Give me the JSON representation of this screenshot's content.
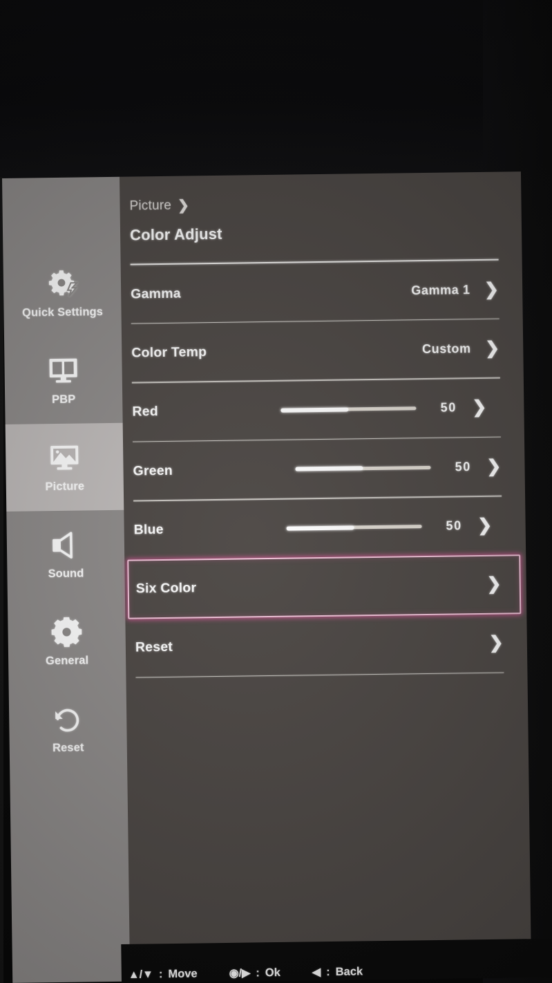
{
  "breadcrumb": {
    "parent": "Picture",
    "separator": "❯"
  },
  "page_title": "Color Adjust",
  "colors": {
    "sidebar_bg": "#8e8b8a",
    "sidebar_active_bg": "#bfbbba",
    "content_bg": "#4c4744",
    "text": "#ffffff",
    "divider": "#c9c6c1",
    "selection_border": "#f0c3d8",
    "selection_glow": "#d65696"
  },
  "sidebar": {
    "items": [
      {
        "label": "Quick Settings",
        "icon": "gear-bolt-icon",
        "active": false
      },
      {
        "label": "PBP",
        "icon": "picture-by-picture-icon",
        "active": false
      },
      {
        "label": "Picture",
        "icon": "picture-monitor-icon",
        "active": true
      },
      {
        "label": "Sound",
        "icon": "speaker-icon",
        "active": false
      },
      {
        "label": "General",
        "icon": "gear-icon",
        "active": false
      },
      {
        "label": "Reset",
        "icon": "reset-arrow-icon",
        "active": false
      }
    ]
  },
  "menu": {
    "rows": [
      {
        "id": "gamma",
        "label": "Gamma",
        "type": "value",
        "value": "Gamma 1",
        "chevron": "❯",
        "selected": false
      },
      {
        "id": "color-temp",
        "label": "Color Temp",
        "type": "value",
        "value": "Custom",
        "chevron": "❯",
        "selected": false
      },
      {
        "id": "red",
        "label": "Red",
        "type": "slider",
        "value": "50",
        "percent": 50,
        "chevron": "❯",
        "selected": false
      },
      {
        "id": "green",
        "label": "Green",
        "type": "slider",
        "value": "50",
        "percent": 50,
        "chevron": "❯",
        "selected": false
      },
      {
        "id": "blue",
        "label": "Blue",
        "type": "slider",
        "value": "50",
        "percent": 50,
        "chevron": "❯",
        "selected": false
      },
      {
        "id": "six-color",
        "label": "Six Color",
        "type": "link",
        "value": "",
        "chevron": "❯",
        "selected": true
      },
      {
        "id": "reset",
        "label": "Reset",
        "type": "link",
        "value": "",
        "chevron": "❯",
        "selected": false
      }
    ]
  },
  "hintbar": {
    "move": {
      "glyph": "▲/▼",
      "sep": ":",
      "label": "Move"
    },
    "ok": {
      "glyph": "◉/▶",
      "sep": ":",
      "label": "Ok"
    },
    "back": {
      "glyph": "◀",
      "sep": ":",
      "label": "Back"
    }
  }
}
